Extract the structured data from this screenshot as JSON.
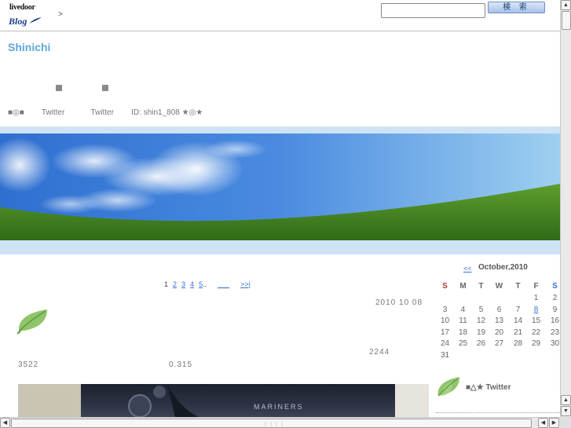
{
  "header": {
    "logo_top": "livedoor",
    "logo_bottom": "Blog",
    "breadcrumb_separator": ">",
    "search_value": "",
    "search_button": "検 索"
  },
  "blog": {
    "title": "Shinichi",
    "profile_line": "■◎■        Twitter            Twitter        ID: shin1_808 ★◎★"
  },
  "main": {
    "pager": {
      "current": "1",
      "pages": [
        "2",
        "3",
        "4",
        "5"
      ],
      "ellipsis": "..",
      "blank_link": "___",
      "last": ">>|"
    },
    "post_date": "2010 10 08",
    "num_a": "2244",
    "num_b": "3522",
    "num_c": "0.315",
    "photo_text": "MARINERS"
  },
  "calendar": {
    "prev": "<<",
    "title": "October,2010",
    "headers": [
      "S",
      "M",
      "T",
      "W",
      "T",
      "F",
      "S"
    ],
    "weeks": [
      [
        "",
        "",
        "",
        "",
        "",
        "1",
        "2"
      ],
      [
        "3",
        "4",
        "5",
        "6",
        "7",
        "8",
        "9"
      ],
      [
        "10",
        "11",
        "12",
        "13",
        "14",
        "15",
        "16"
      ],
      [
        "17",
        "18",
        "19",
        "20",
        "21",
        "22",
        "23"
      ],
      [
        "24",
        "25",
        "26",
        "27",
        "28",
        "29",
        "30"
      ],
      [
        "31",
        "",
        "",
        "",
        "",
        "",
        ""
      ]
    ],
    "linked_day": "8"
  },
  "sidebar": {
    "heading": "■△★ Twitter"
  },
  "colors": {
    "title_blue": "#5ea7dc",
    "band_blue": "#cfe3f7",
    "link_blue": "#3a6fd0",
    "sunday_red": "#c0392b"
  }
}
